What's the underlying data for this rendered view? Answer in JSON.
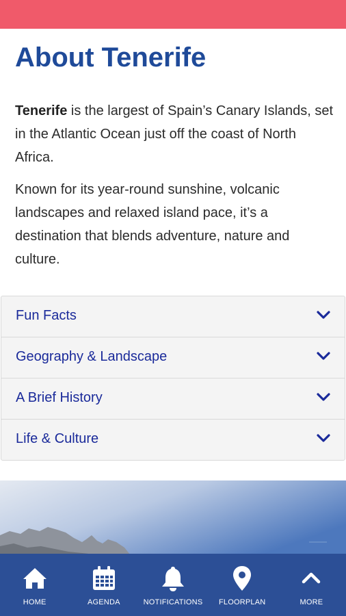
{
  "colors": {
    "top_bar": "#f05a6a",
    "title": "#1f4a99",
    "accordion_text": "#1a2a9a",
    "nav_bg": "#2c4f96",
    "nav_text": "#ffffff"
  },
  "page": {
    "title": "About Tenerife",
    "intro_bold": "Tenerife",
    "intro_rest": " is the largest of Spain’s Canary Islands, set in the Atlantic Ocean just off the coast of North Africa.",
    "paragraph_2": "Known for its year-round sunshine, volcanic landscapes and relaxed island pace, it’s a destination that blends adventure, nature and culture."
  },
  "accordion": [
    {
      "label": "Fun Facts",
      "icon": "chevron-down-icon"
    },
    {
      "label": "Geography & Landscape",
      "icon": "chevron-down-icon"
    },
    {
      "label": "A Brief History",
      "icon": "chevron-down-icon"
    },
    {
      "label": "Life & Culture",
      "icon": "chevron-down-icon"
    }
  ],
  "hero_image": {
    "icon": "mountain-landscape-image"
  },
  "bottom_nav": [
    {
      "label": "HOME",
      "icon": "home-icon"
    },
    {
      "label": "AGENDA",
      "icon": "calendar-icon"
    },
    {
      "label": "NOTIFICATIONS",
      "icon": "bell-icon"
    },
    {
      "label": "FLOORPLAN",
      "icon": "map-pin-icon"
    },
    {
      "label": "MORE",
      "icon": "chevron-up-icon"
    }
  ]
}
